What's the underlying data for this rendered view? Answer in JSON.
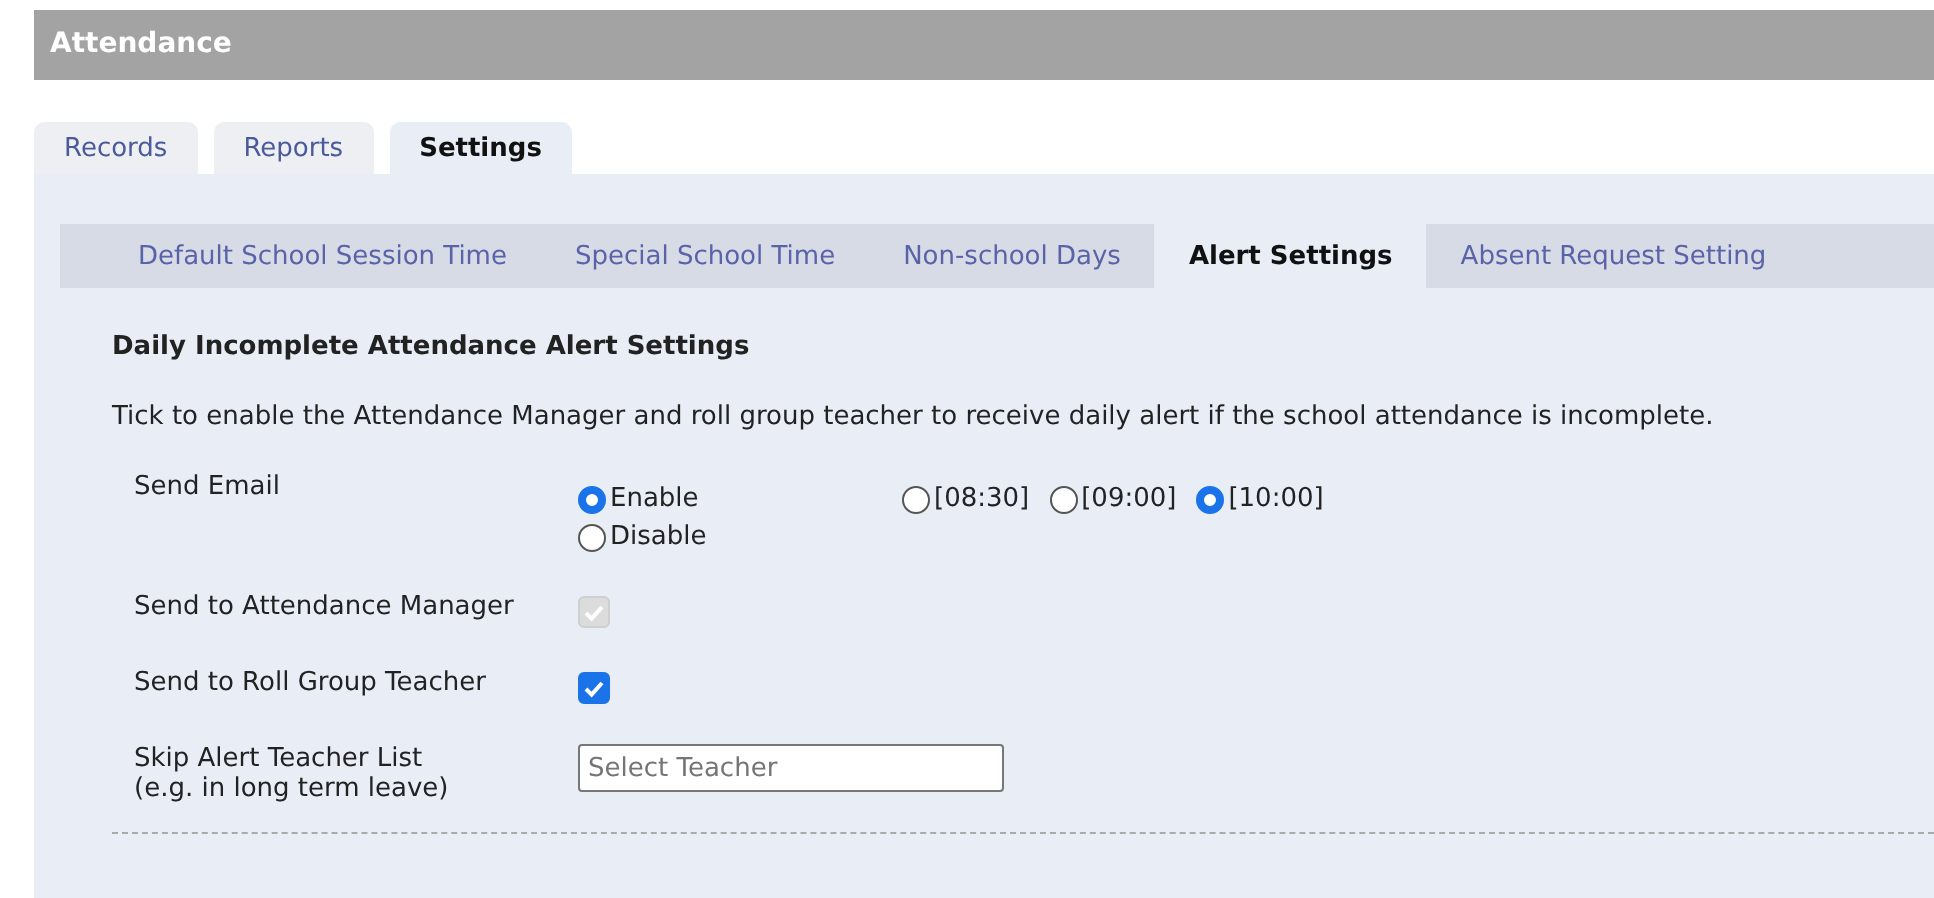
{
  "window": {
    "title": "Attendance"
  },
  "tabs": [
    {
      "label": "Records",
      "selected": false
    },
    {
      "label": "Reports",
      "selected": false
    },
    {
      "label": "Settings",
      "selected": true
    }
  ],
  "subtabs": [
    {
      "label": "Default School Session Time",
      "selected": false
    },
    {
      "label": "Special School Time",
      "selected": false
    },
    {
      "label": "Non-school Days",
      "selected": false
    },
    {
      "label": "Alert Settings",
      "selected": true
    },
    {
      "label": "Absent Request Setting",
      "selected": false
    }
  ],
  "section": {
    "title": "Daily Incomplete Attendance Alert Settings",
    "description": "Tick to enable the Attendance Manager and roll group teacher to receive daily alert if the school attendance is incomplete."
  },
  "rows": [
    {
      "kind": "radio",
      "label": "Send Email",
      "options": [
        {
          "label": "Enable",
          "selected": true
        },
        {
          "label": "Disable",
          "selected": false
        }
      ],
      "times": [
        {
          "label": "[08:30]",
          "selected": false
        },
        {
          "label": "[09:00]",
          "selected": false
        },
        {
          "label": "[10:00]",
          "selected": true
        }
      ]
    },
    {
      "kind": "checkbox",
      "label": "Send to Attendance Manager",
      "checked": true,
      "disabled": true
    },
    {
      "kind": "checkbox",
      "label": "Send to Roll Group Teacher",
      "checked": true,
      "disabled": false
    },
    {
      "kind": "select",
      "label": "Skip Alert Teacher List",
      "note": "(e.g. in long term leave)",
      "placeholder": "Select Teacher"
    }
  ]
}
